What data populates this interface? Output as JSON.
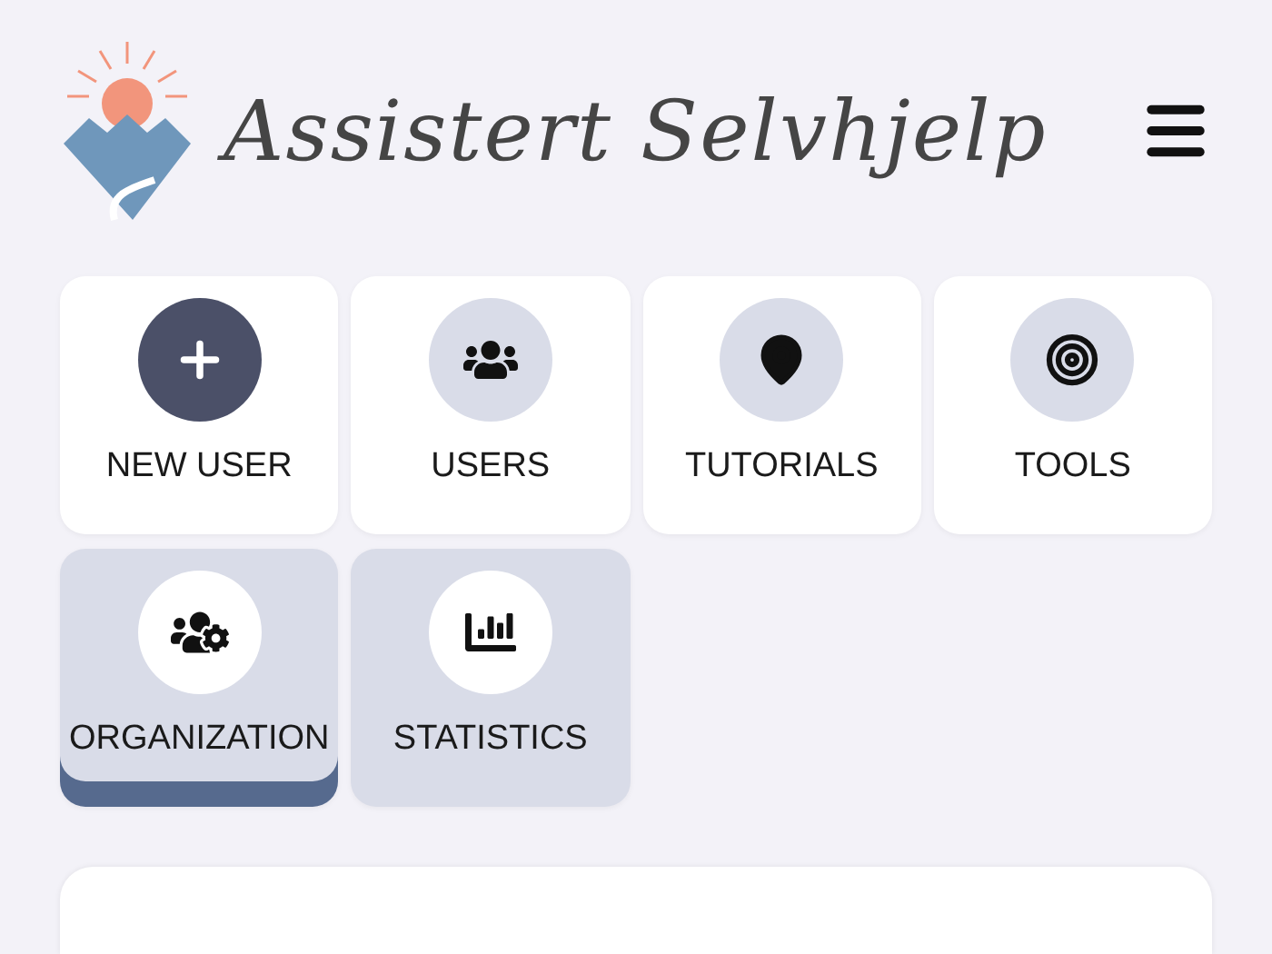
{
  "header": {
    "title": "Assistert Selvhjelp"
  },
  "tiles": [
    {
      "label": "NEW USER",
      "kind": "action",
      "selected": false
    },
    {
      "label": "USERS",
      "kind": "section",
      "selected": false
    },
    {
      "label": "TUTORIALS",
      "kind": "section",
      "selected": false
    },
    {
      "label": "TOOLS",
      "kind": "section",
      "selected": false
    },
    {
      "label": "ORGANIZATION",
      "kind": "admin",
      "selected": true
    },
    {
      "label": "STATISTICS",
      "kind": "admin",
      "selected": false
    }
  ]
}
